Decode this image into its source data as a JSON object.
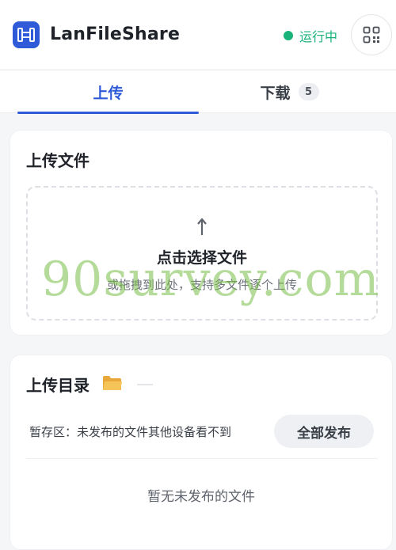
{
  "header": {
    "app_title": "LanFileShare",
    "status_text": "运行中",
    "icons": {
      "logo": "transfer-logo-icon",
      "qr": "qr-code-icon"
    }
  },
  "tabs": [
    {
      "label": "上传",
      "active": true
    },
    {
      "label": "下载",
      "badge": "5",
      "active": false
    }
  ],
  "upload_card": {
    "title": "上传文件",
    "dropzone": {
      "title": "点击选择文件",
      "hint": "或拖拽到此处，支持多文件逐个上传",
      "icon": "upload-arrow-icon"
    }
  },
  "directory_card": {
    "title": "上传目录",
    "folder_icon": "folder-icon",
    "staging_label": "暂存区：未发布的文件其他设备看不到",
    "publish_all_label": "全部发布",
    "empty_text": "暂无未发布的文件"
  },
  "watermark": {
    "text": "90survey.com"
  },
  "colors": {
    "accent": "#2f5bd8",
    "status": "#19b37a",
    "background": "#f5f6f8"
  }
}
